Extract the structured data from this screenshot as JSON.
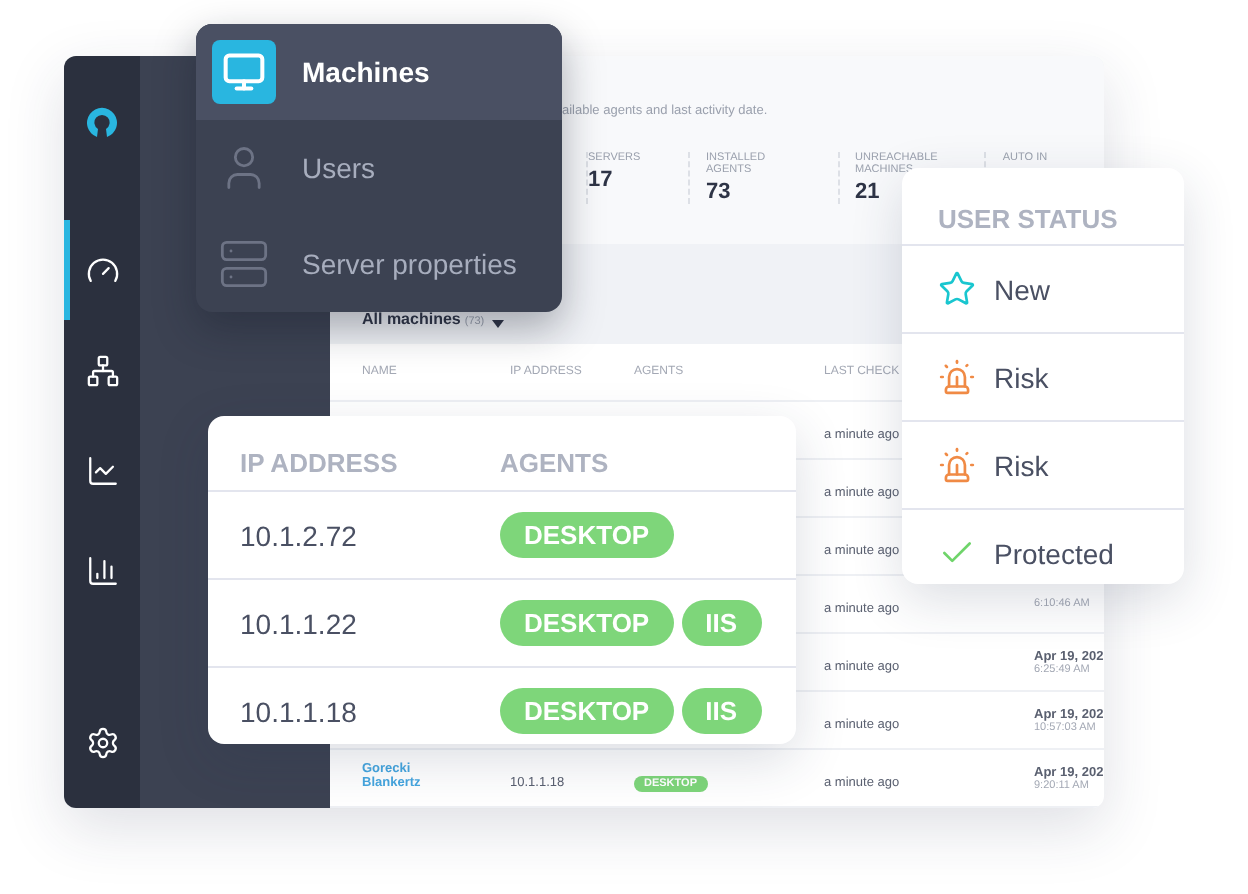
{
  "sidebar": {
    "items": [
      {
        "kind": "gauge",
        "selected": true
      },
      {
        "kind": "network",
        "selected": false
      },
      {
        "kind": "line-chart",
        "selected": false
      },
      {
        "kind": "bar-chart",
        "selected": false
      },
      {
        "kind": "settings",
        "selected": false
      }
    ]
  },
  "header": {
    "subtitle": "ailable agents and last activity date.",
    "stats": [
      {
        "label": "SERVERS",
        "value": "17"
      },
      {
        "label": "INSTALLED AGENTS",
        "value": "73"
      },
      {
        "label": "UNREACHABLE MACHINES",
        "value": "21"
      },
      {
        "label": "AUTO IN"
      }
    ]
  },
  "table": {
    "filter": "All machines",
    "count": "(73)",
    "columns": [
      "NAME",
      "IP ADDRESS",
      "AGENTS",
      "LAST CHECK"
    ],
    "rows": [
      {
        "last_check": "a minute ago"
      },
      {
        "last_check": "a minute ago"
      },
      {
        "last_check": "a minute ago"
      },
      {
        "last_check": "a minute ago",
        "time": "6:10:46 AM"
      },
      {
        "last_check": "a minute ago",
        "date": "Apr 19, 202",
        "time": "6:25:49 AM"
      },
      {
        "last_check": "a minute ago",
        "date": "Apr 19, 202",
        "time": "10:57:03 AM"
      },
      {
        "name": "Gorecki Blankertz",
        "ip": "10.1.1.18",
        "agents": [
          "DESKTOP"
        ],
        "last_check": "a minute ago",
        "date": "Apr 19, 202",
        "time": "9:20:11 AM"
      }
    ]
  },
  "menu": {
    "items": [
      {
        "kind": "monitor",
        "label": "Machines",
        "selected": true
      },
      {
        "kind": "user",
        "label": "Users",
        "selected": false
      },
      {
        "kind": "server",
        "label": "Server properties",
        "selected": false
      }
    ]
  },
  "ip_card": {
    "columns": [
      "IP ADDRESS",
      "AGENTS"
    ],
    "rows": [
      {
        "ip": "10.1.2.72",
        "agents": [
          "DESKTOP"
        ]
      },
      {
        "ip": "10.1.1.22",
        "agents": [
          "DESKTOP",
          "IIS"
        ]
      },
      {
        "ip": "10.1.1.18",
        "agents": [
          "DESKTOP",
          "IIS"
        ]
      }
    ]
  },
  "status_card": {
    "title": "USER STATUS",
    "items": [
      {
        "kind": "new",
        "label": "New"
      },
      {
        "kind": "risk",
        "label": "Risk"
      },
      {
        "kind": "risk",
        "label": "Risk"
      },
      {
        "kind": "protected",
        "label": "Protected"
      }
    ]
  }
}
